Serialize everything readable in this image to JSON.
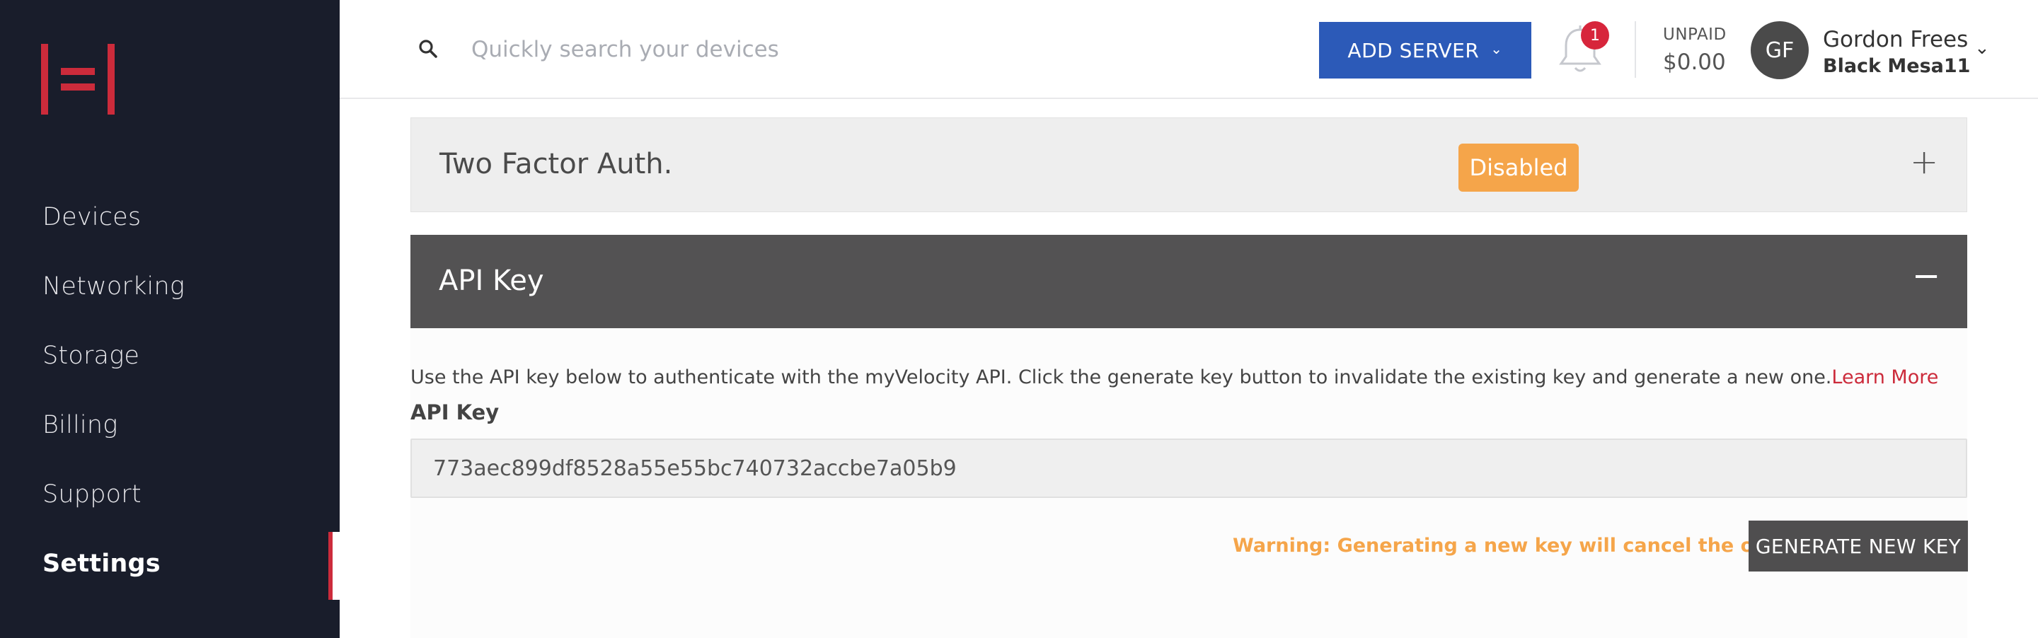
{
  "sidebar": {
    "items": [
      {
        "label": "Devices"
      },
      {
        "label": "Networking"
      },
      {
        "label": "Storage"
      },
      {
        "label": "Billing"
      },
      {
        "label": "Support"
      },
      {
        "label": "Settings",
        "active": true
      }
    ],
    "accent_color": "#cc2b3b",
    "background": "#191d2b"
  },
  "header": {
    "search": {
      "placeholder": "Quickly search your devices",
      "value": ""
    },
    "add_server_label": "ADD SERVER",
    "notifications_count": "1",
    "billing": {
      "status": "UNPAID",
      "amount": "$0.00"
    },
    "user": {
      "initials": "GF",
      "name": "Gordon Frees",
      "org": "Black Mesa11"
    }
  },
  "two_factor": {
    "title": "Two Factor Auth.",
    "status": "Disabled",
    "toggle": "+"
  },
  "api_key_panel": {
    "title": "API Key",
    "toggle": "−",
    "description": "Use the API key below to authenticate with the myVelocity API. Click the generate key button to invalidate the existing key and generate a new one.",
    "learn_more": "Learn More",
    "field_label": "API Key",
    "key_value": "773aec899df8528a55e55bc740732accbe7a05b9",
    "warning": "Warning: Generating a new key will cancel the old key.",
    "generate_label": "GENERATE NEW KEY"
  },
  "colors": {
    "primary_button": "#2c5ab8",
    "warning": "#f5a54a",
    "panel_dark": "#535253",
    "badge_red": "#d7253b"
  }
}
